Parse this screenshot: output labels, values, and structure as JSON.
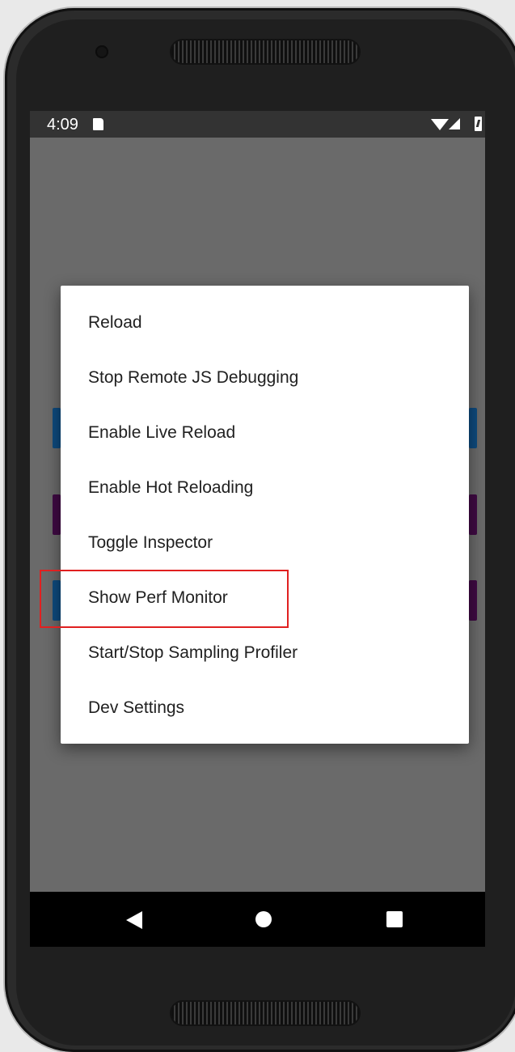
{
  "status_bar": {
    "time": "4:09",
    "icons": [
      "sd-card-icon",
      "wifi-icon",
      "signal-icon",
      "battery-charging-icon"
    ]
  },
  "dev_menu": {
    "items": [
      {
        "label": "Reload"
      },
      {
        "label": "Stop Remote JS Debugging"
      },
      {
        "label": "Enable Live Reload"
      },
      {
        "label": "Enable Hot Reloading"
      },
      {
        "label": "Toggle Inspector"
      },
      {
        "label": "Show Perf Monitor"
      },
      {
        "label": "Start/Stop Sampling Profiler"
      },
      {
        "label": "Dev Settings"
      }
    ],
    "highlighted_item": "Dev Settings",
    "highlight_color": "#e02020"
  },
  "nav_bar": {
    "buttons": [
      "back-icon",
      "home-icon",
      "recents-icon"
    ]
  },
  "colors": {
    "screen_dim": "#6a6a6a",
    "background_button_blue": "#0e4a7e",
    "background_button_purple": "#3f0a43"
  }
}
